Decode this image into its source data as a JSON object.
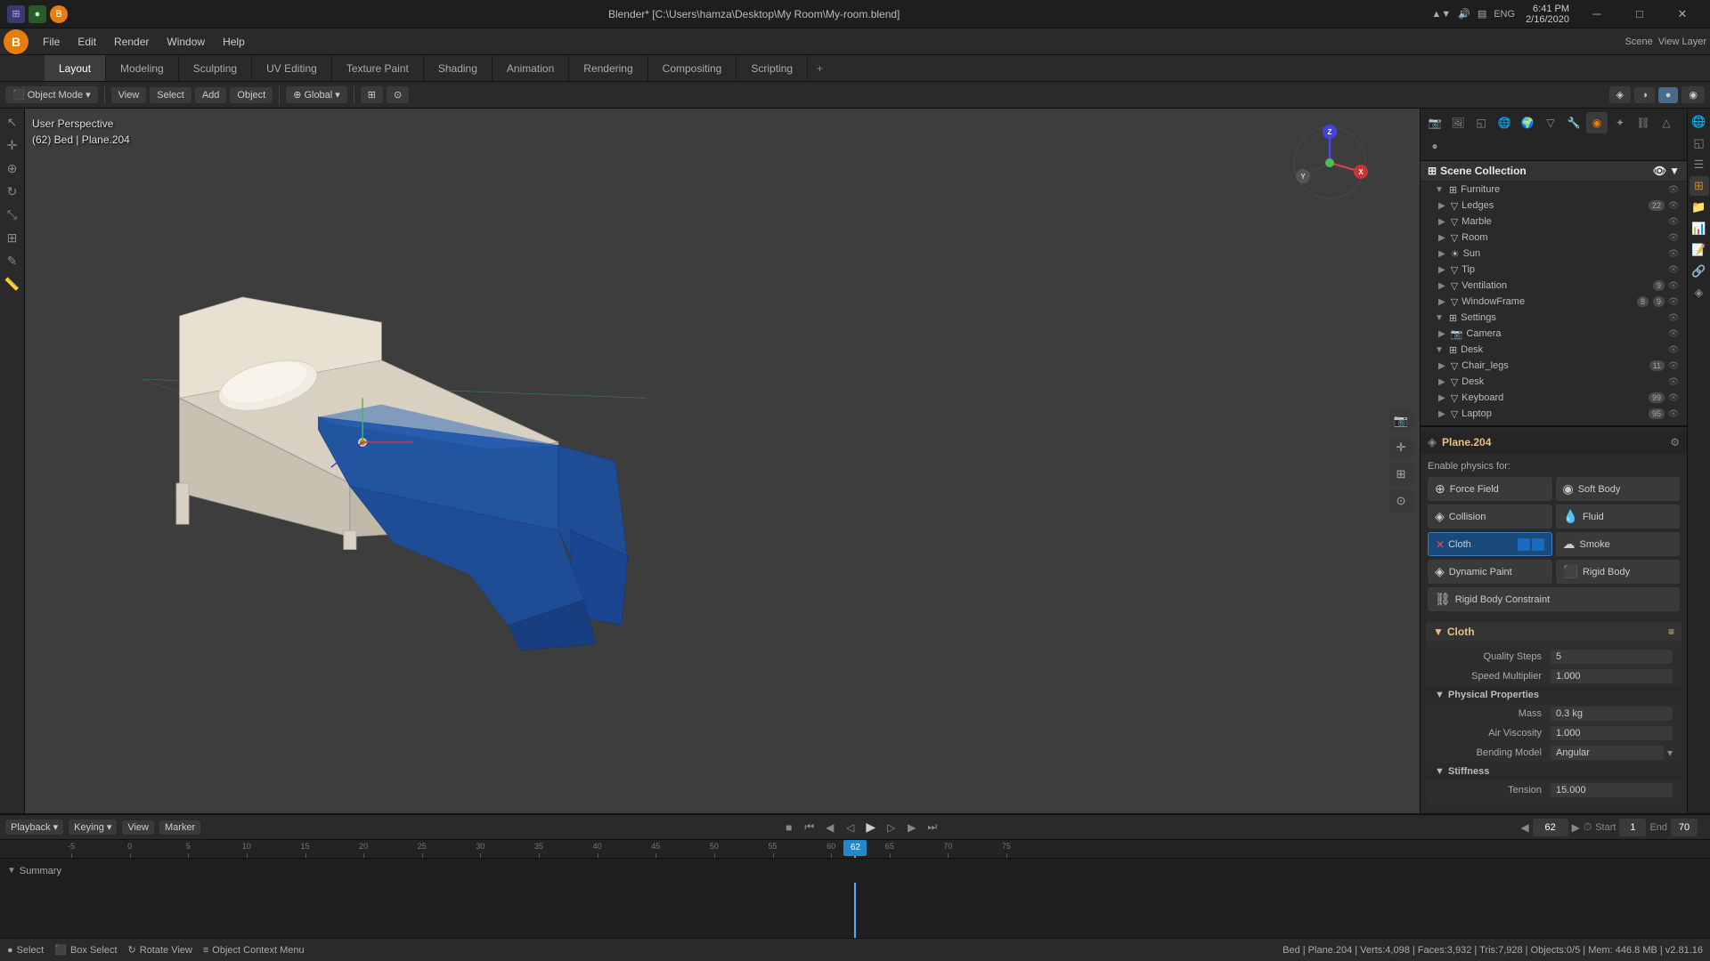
{
  "titlebar": {
    "title": "Blender* [C:\\Users\\hamza\\Desktop\\My Room\\My-room.blend]",
    "time": "6:41 PM",
    "date": "2/16/2020",
    "close_label": "✕",
    "min_label": "─",
    "max_label": "□"
  },
  "menubar": {
    "items": [
      "File",
      "Edit",
      "Render",
      "Window",
      "Help"
    ]
  },
  "workspacetabs": {
    "tabs": [
      "Layout",
      "Modeling",
      "Sculpting",
      "UV Editing",
      "Texture Paint",
      "Shading",
      "Animation",
      "Rendering",
      "Compositing",
      "Scripting"
    ],
    "active": "Layout"
  },
  "toolbar": {
    "mode": "Object Mode",
    "view_label": "View",
    "select_label": "Select",
    "add_label": "Add",
    "object_label": "Object",
    "transform": "Global"
  },
  "viewport": {
    "label_line1": "User Perspective",
    "label_line2": "(62) Bed | Plane.204"
  },
  "scene_collection": {
    "title": "Scene Collection",
    "collections": [
      {
        "name": "Furniture",
        "level": 0,
        "expanded": true,
        "has_eye": true
      },
      {
        "name": "Ledges",
        "level": 1,
        "badge": "22",
        "has_eye": true
      },
      {
        "name": "Marble",
        "level": 1,
        "has_eye": true
      },
      {
        "name": "Room",
        "level": 1,
        "has_eye": true
      },
      {
        "name": "Sun",
        "level": 1,
        "has_eye": true
      },
      {
        "name": "Tip",
        "level": 1,
        "has_eye": true
      },
      {
        "name": "Ventilation",
        "level": 1,
        "badge": "9",
        "has_eye": true
      },
      {
        "name": "WindowFrame",
        "level": 1,
        "badge_b": "8",
        "badge_n": "9",
        "has_eye": true
      },
      {
        "name": "Settings",
        "level": 0,
        "expanded": true,
        "has_eye": true
      },
      {
        "name": "Camera",
        "level": 1,
        "has_eye": true
      },
      {
        "name": "Desk",
        "level": 0,
        "expanded": true,
        "has_eye": true
      },
      {
        "name": "Chair_legs",
        "level": 1,
        "badge": "11",
        "has_eye": true
      },
      {
        "name": "Desk",
        "level": 1,
        "has_eye": true
      },
      {
        "name": "Keyboard",
        "level": 1,
        "badge": "99",
        "has_eye": true
      },
      {
        "name": "Laptop",
        "level": 1,
        "badge": "95",
        "has_eye": true
      }
    ]
  },
  "object_properties": {
    "name": "Plane.204",
    "physics_label": "Enable physics for:",
    "physics_buttons": [
      {
        "id": "force-field",
        "label": "Force Field",
        "active": false
      },
      {
        "id": "soft-body",
        "label": "Soft Body",
        "active": false
      },
      {
        "id": "collision",
        "label": "Collision",
        "active": false
      },
      {
        "id": "fluid",
        "label": "Fluid",
        "active": false
      },
      {
        "id": "cloth",
        "label": "Cloth",
        "active": true
      },
      {
        "id": "smoke",
        "label": "Smoke",
        "active": false
      },
      {
        "id": "dynamic-paint",
        "label": "Dynamic Paint",
        "active": false
      },
      {
        "id": "rigid-body",
        "label": "Rigid Body",
        "active": false
      },
      {
        "id": "rigid-body-constraint",
        "label": "Rigid Body Constraint",
        "active": false
      }
    ],
    "cloth_section": {
      "title": "Cloth",
      "quality_steps_label": "Quality Steps",
      "quality_steps_value": "5",
      "speed_multiplier_label": "Speed Multiplier",
      "speed_multiplier_value": "1.000",
      "physical_properties": {
        "title": "Physical Properties",
        "mass_label": "Mass",
        "mass_value": "0.3 kg",
        "air_viscosity_label": "Air Viscosity",
        "air_viscosity_value": "1.000",
        "bending_model_label": "Bending Model",
        "bending_model_value": "Angular"
      },
      "stiffness": {
        "title": "Stiffness",
        "tension_label": "Tension",
        "tension_value": "15.000"
      }
    }
  },
  "timeline": {
    "playback_label": "Playback",
    "keying_label": "Keying",
    "view_label": "View",
    "marker_label": "Marker",
    "frame_current": "62",
    "frame_start": "1",
    "frame_end": "70",
    "start_label": "Start",
    "end_label": "End",
    "summary_label": "Summary",
    "ruler_marks": [
      "-5",
      "0",
      "5",
      "10",
      "15",
      "20",
      "25",
      "30",
      "35",
      "40",
      "45",
      "50",
      "55",
      "60",
      "65",
      "70",
      "75"
    ]
  },
  "statusbar": {
    "select_label": "Select",
    "box_select_label": "Box Select",
    "rotate_view_label": "Rotate View",
    "context_menu_label": "Object Context Menu",
    "info": "Bed | Plane.204 | Verts:4,098 | Faces:3,932 | Tris:7,928 | Objects:0/5 | Mem: 446.8 MB | v2.81.16"
  }
}
